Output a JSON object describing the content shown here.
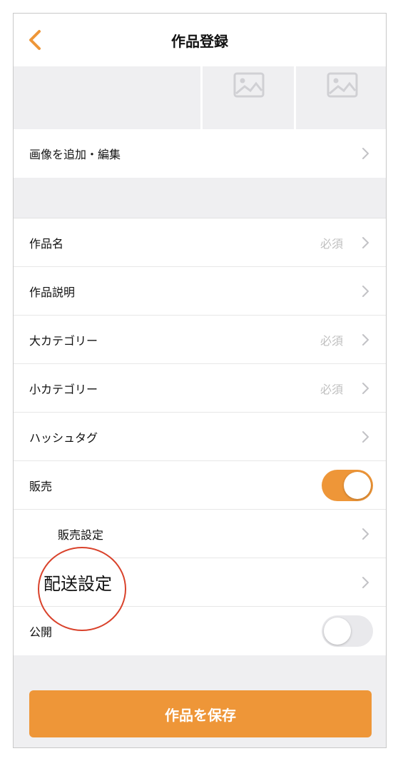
{
  "header": {
    "title": "作品登録"
  },
  "images": {
    "add_edit_label": "画像を追加・編集"
  },
  "fields": [
    {
      "label": "作品名",
      "badge": "必須"
    },
    {
      "label": "作品説明",
      "badge": ""
    },
    {
      "label": "大カテゴリー",
      "badge": "必須"
    },
    {
      "label": "小カテゴリー",
      "badge": "必須"
    },
    {
      "label": "ハッシュタグ",
      "badge": ""
    }
  ],
  "sale": {
    "label": "販売",
    "enabled": true
  },
  "sale_settings": {
    "label": "販売設定"
  },
  "shipping_settings": {
    "label": "配送設定"
  },
  "publish": {
    "label": "公開",
    "enabled": false
  },
  "save_button": {
    "label": "作品を保存"
  },
  "colors": {
    "accent": "#ee9638",
    "annotation_circle": "#d9422b",
    "toggle_off": "#e9e9ec",
    "required_text": "#bfbfbf"
  },
  "icons": [
    "back-chevron-icon",
    "image-placeholder-icon",
    "chevron-right-icon"
  ]
}
